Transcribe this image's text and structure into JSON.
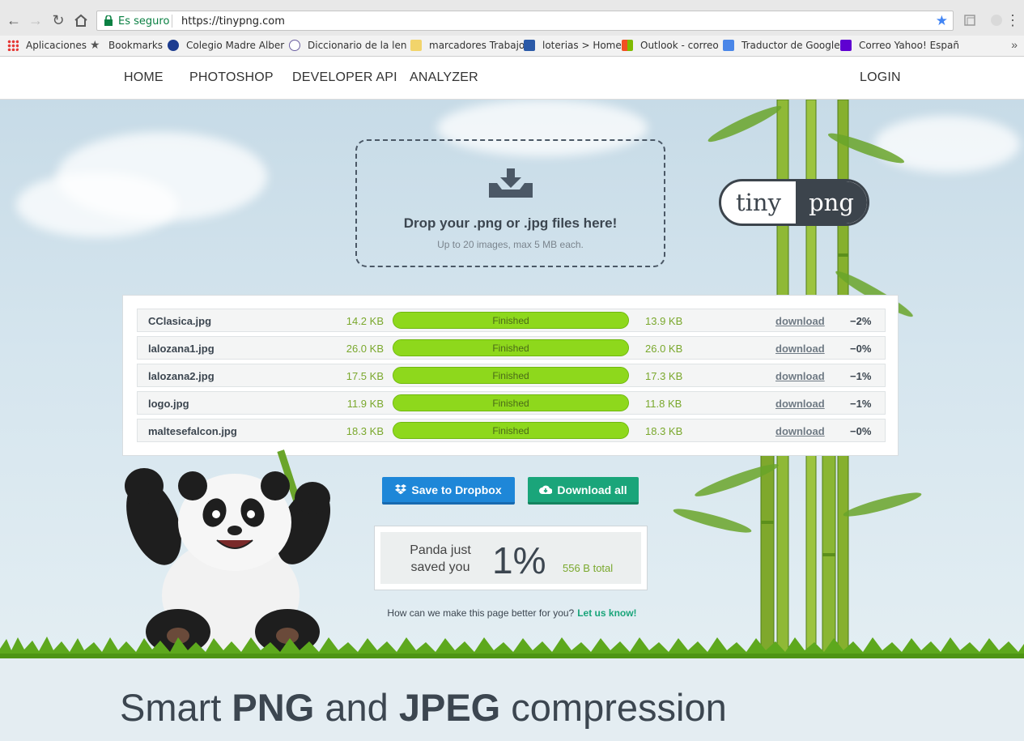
{
  "browser": {
    "secure_label": "Es seguro",
    "url": "https://tinypng.com",
    "bookmarks": [
      {
        "label": "Aplicaciones",
        "icon": "apps-grid-icon"
      },
      {
        "label": "Bookmarks",
        "icon": "star-icon"
      },
      {
        "label": "Colegio Madre Alber",
        "icon": "school-icon"
      },
      {
        "label": "Diccionario de la len",
        "icon": "dictionary-icon"
      },
      {
        "label": "marcadores Trabajo",
        "icon": "folder-icon"
      },
      {
        "label": "loterias > Home",
        "icon": "lottery-icon"
      },
      {
        "label": "Outlook - correo",
        "icon": "outlook-icon"
      },
      {
        "label": "Traductor de Google",
        "icon": "translate-icon"
      },
      {
        "label": "Correo Yahoo! Españ",
        "icon": "yahoo-icon"
      }
    ]
  },
  "nav": {
    "home": "HOME",
    "photoshop": "PHOTOSHOP",
    "developer_api": "DEVELOPER API",
    "analyzer": "ANALYZER",
    "login": "LOGIN"
  },
  "dropzone": {
    "title": "Drop your .png or .jpg files here!",
    "subtitle": "Up to 20 images, max 5 MB each."
  },
  "logo": {
    "left": "tiny",
    "right": "png"
  },
  "files": [
    {
      "name": "CClasica.jpg",
      "original": "14.2 KB",
      "status": "Finished",
      "progress": 1.0,
      "compressed": "13.9 KB",
      "link": "download",
      "change": "−2%"
    },
    {
      "name": "lalozana1.jpg",
      "original": "26.0 KB",
      "status": "Finished",
      "progress": 1.0,
      "compressed": "26.0 KB",
      "link": "download",
      "change": "−0%"
    },
    {
      "name": "lalozana2.jpg",
      "original": "17.5 KB",
      "status": "Finished",
      "progress": 1.0,
      "compressed": "17.3 KB",
      "link": "download",
      "change": "−1%"
    },
    {
      "name": "logo.jpg",
      "original": "11.9 KB",
      "status": "Finished",
      "progress": 1.0,
      "compressed": "11.8 KB",
      "link": "download",
      "change": "−1%"
    },
    {
      "name": "maltesefalcon.jpg",
      "original": "18.3 KB",
      "status": "Finished",
      "progress": 1.0,
      "compressed": "18.3 KB",
      "link": "download",
      "change": "−0%"
    }
  ],
  "actions": {
    "dropbox": "Save to Dropbox",
    "download_all": "Download all"
  },
  "summary": {
    "text_line1": "Panda just",
    "text_line2": "saved you",
    "percent": "1%",
    "total": "556 B total"
  },
  "feedback": {
    "question": "How can we make this page better for you?",
    "link": "Let us know!"
  },
  "section": {
    "heading_part1": "Smart ",
    "heading_bold1": "PNG",
    "heading_part2": " and ",
    "heading_bold2": "JPEG",
    "heading_part3": " compression"
  },
  "colors": {
    "progress": "#8ed81c",
    "dropbox": "#1e87d8",
    "download": "#1aa57a",
    "size_text": "#7aa82d"
  }
}
